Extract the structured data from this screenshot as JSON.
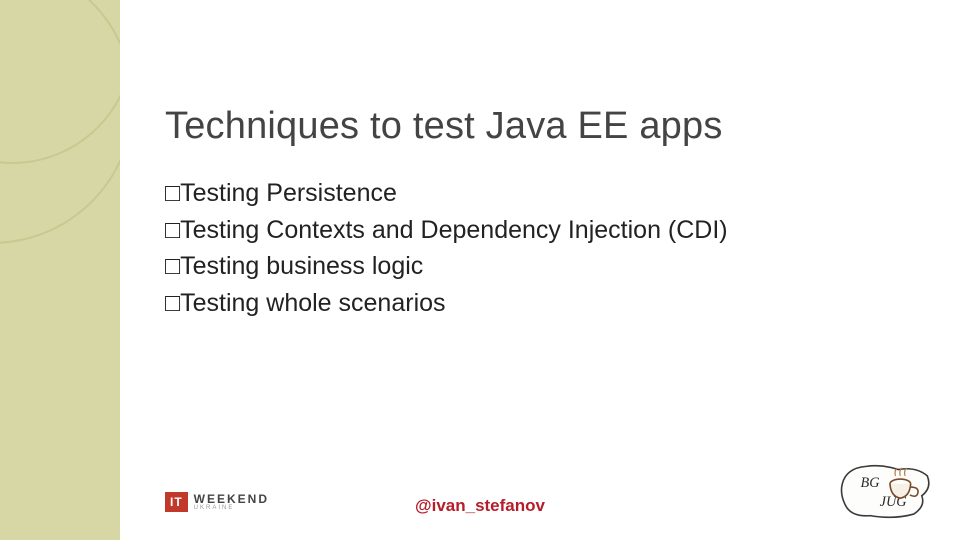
{
  "title": "Techniques to test Java EE apps",
  "bullet_marker": "□",
  "bullets": [
    "Testing Persistence",
    "Testing Contexts and Dependency Injection (CDI)",
    "Testing business logic",
    "Testing whole scenarios"
  ],
  "footer": {
    "handle": "@ivan_stefanov",
    "itweekend": {
      "badge": "IT",
      "main": "WEEKEND",
      "sub": "UKRAINE"
    },
    "bgjug": {
      "label_top": "BG",
      "label_bottom": "JUG"
    }
  }
}
